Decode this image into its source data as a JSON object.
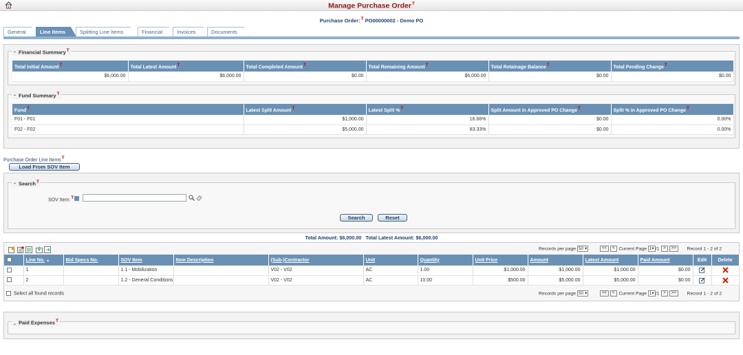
{
  "title": "Manage Purchase Order",
  "t_mark": "T",
  "po": {
    "label": "Purchase Order:",
    "value": "PO00000002 - Demo PO"
  },
  "tabs": [
    "General",
    "Line Items",
    "Splitting Line Items",
    "Financial",
    "Invoices",
    "Documents"
  ],
  "financial_summary": {
    "title": "Financial Summary",
    "headers": [
      "Total Initial Amount",
      "Total Latest Amount",
      "Total Completed Amount",
      "Total Remaining Amount",
      "Total Retainage Balance",
      "Total Pending Change"
    ],
    "values": [
      "$6,000.00",
      "$6,000.00",
      "$0.00",
      "$6,000.00",
      "$0.00",
      "$0.00"
    ]
  },
  "fund_summary": {
    "title": "Fund Summary",
    "headers": [
      "Fund",
      "Latest Split Amount",
      "Latest Split %",
      "Split Amount in Approved PO Change",
      "Split % in Approved PO Change"
    ],
    "rows": [
      [
        "F01 - F01",
        "$1,000.00",
        "16.66%",
        "$0.00",
        "0.00%"
      ],
      [
        "F02 - F02",
        "$5,000.00",
        "83.33%",
        "$0.00",
        "0.00%"
      ]
    ]
  },
  "line_items_label": "Purchase Order Line Items",
  "load_button": "Load From SOV Item",
  "search": {
    "title": "Search",
    "sov_label": "SOV Item:",
    "sov_value": "",
    "search_btn": "Search",
    "reset_btn": "Reset"
  },
  "totals": "Total Amount: $6,000.00   Total Latest Amount: $6,000.00",
  "pager": {
    "rpp_label": "Records per page",
    "rpp": "50",
    "first": "<<",
    "prev": "<",
    "current_label": "Current Page",
    "page": "1",
    "of": "/1",
    "next": ">",
    "last": ">>",
    "record": "Record 1 - 2 of 2"
  },
  "grid": {
    "headers": [
      "Line No.",
      "Bid Specs No.",
      "SOV Item",
      "Item Description",
      "(Sub-)Contractor",
      "Unit",
      "Quantity",
      "Unit Price",
      "Amount",
      "Latest Amount",
      "Paid Amount",
      "Edit",
      "Delete"
    ],
    "sort_arrow": "▲",
    "rows": [
      [
        "1",
        "",
        "1.1 - Mobilization",
        "",
        "V02 - V02",
        "AC",
        "1.00",
        "$1,000.00",
        "$1,000.00",
        "$1,000.00",
        "$0.00"
      ],
      [
        "2",
        "",
        "1.2 - General Conditions",
        "",
        "V02 - V02",
        "AC",
        "10.00",
        "$500.00",
        "$5,000.00",
        "$5,000.00",
        "$0.00"
      ]
    ]
  },
  "select_all": "Select all found records",
  "paid_expenses": "Paid Expenses",
  "colors": {
    "header_blue": "#6a90b4",
    "title_red": "#8b1a1a",
    "delete_red": "#cc2200"
  }
}
